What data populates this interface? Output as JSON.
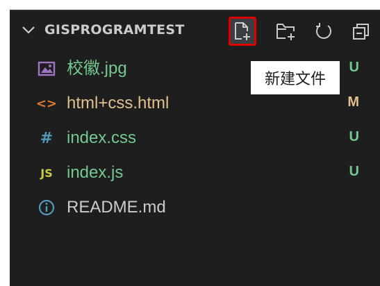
{
  "explorer": {
    "title": "GISPROGRAMTEST",
    "tooltip": "新建文件",
    "actions": [
      {
        "name": "new-file",
        "icon": "new-file-icon",
        "active": true
      },
      {
        "name": "new-folder",
        "icon": "new-folder-icon",
        "active": false
      },
      {
        "name": "refresh",
        "icon": "refresh-icon",
        "active": false
      },
      {
        "name": "collapse-all",
        "icon": "collapse-all-icon",
        "active": false
      }
    ],
    "files": [
      {
        "name": "校徽.jpg",
        "icon": "image-icon",
        "icon_text": "",
        "status": "U",
        "state": "untracked"
      },
      {
        "name": "html+css.html",
        "icon": "html-icon",
        "icon_text": "<>",
        "status": "M",
        "state": "modified"
      },
      {
        "name": "index.css",
        "icon": "css-icon",
        "icon_text": "#",
        "status": "U",
        "state": "untracked"
      },
      {
        "name": "index.js",
        "icon": "js-icon",
        "icon_text": "JS",
        "status": "U",
        "state": "untracked"
      },
      {
        "name": "README.md",
        "icon": "info-icon",
        "icon_text": "",
        "status": "",
        "state": "plain"
      }
    ]
  },
  "colors": {
    "background": "#1e1e1e",
    "untracked": "#73c991",
    "modified": "#e2c08d",
    "html_icon": "#e37933",
    "css_icon": "#519aba",
    "js_icon": "#cbcb41",
    "info_icon": "#519aba",
    "image_icon": "#a074c4",
    "highlight_border": "#e00000"
  }
}
